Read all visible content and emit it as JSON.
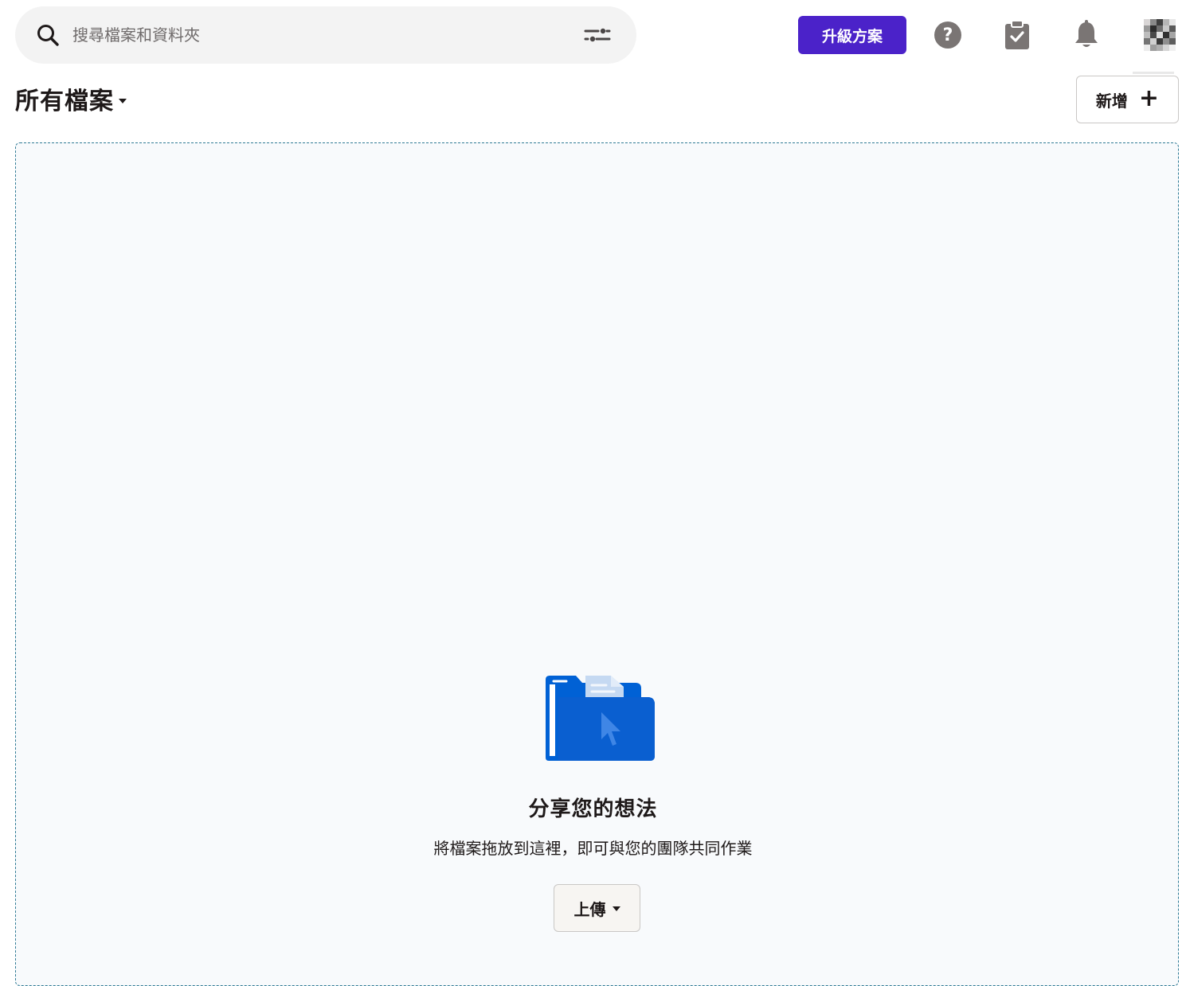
{
  "search": {
    "placeholder": "搜尋檔案和資料夾"
  },
  "header": {
    "upgrade_label": "升級方案",
    "accent_color": "#4b22c9"
  },
  "title_row": {
    "title": "所有檔案"
  },
  "new_button": {
    "label": "新增",
    "icon": "plus-icon"
  },
  "empty_state": {
    "title": "分享您的想法",
    "subtitle": "將檔案拖放到這裡，即可與您的團隊共同作業",
    "upload_label": "上傳",
    "illustration": "folder-drop-illustration",
    "folder_color": "#0061d5"
  },
  "icons": [
    "search-icon",
    "filter-icon",
    "help-icon",
    "tasks-icon",
    "bell-icon",
    "avatar"
  ]
}
